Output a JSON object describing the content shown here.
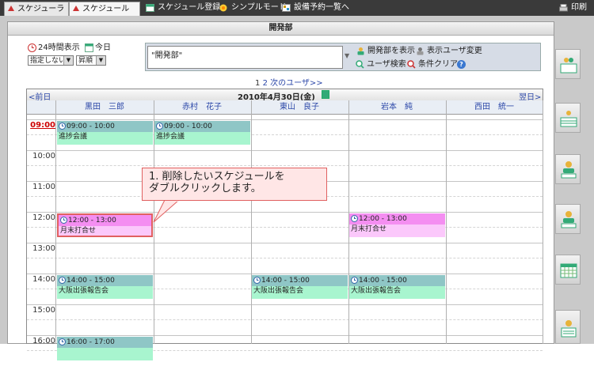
{
  "top_tabs": [
    "スケジューラ",
    "スケジュール"
  ],
  "top_links": [
    "スケジュール登録",
    "シンプルモード",
    "設備予約一覧へ"
  ],
  "print_label": "印刷",
  "panel_title": "開発部",
  "controls": {
    "show24": "24時間表示",
    "today": "今日",
    "sort_field": "指定しない",
    "sort_order": "昇順",
    "group_value": "\"開発部\"",
    "btn_show_group": "開発部を表示",
    "btn_change_users": "表示ユーザ変更",
    "btn_user_search": "ユーザ検索",
    "btn_clear": "条件クリア"
  },
  "pager": {
    "current": "1",
    "next": "2",
    "next_users": "次のユーザ>>"
  },
  "date_nav": {
    "prev": "<前日",
    "date": "2010年4月30日(金)",
    "next": "翌日>"
  },
  "users": [
    "黒田　三郎",
    "赤村　花子",
    "東山　良子",
    "岩本　純",
    "西田　統一"
  ],
  "hours": [
    "09:00",
    "10:00",
    "11:00",
    "12:00",
    "13:00",
    "14:00",
    "15:00",
    "16:00"
  ],
  "events": [
    {
      "time": "09:00 - 10:00",
      "title": "進捗会議",
      "user": "黒田　三郎",
      "color": "teal"
    },
    {
      "time": "09:00 - 10:00",
      "title": "進捗会議",
      "user": "赤村　花子",
      "color": "teal"
    },
    {
      "time": "12:00 - 13:00",
      "title": "月末打合せ",
      "user": "黒田　三郎",
      "color": "pink"
    },
    {
      "time": "12:00 - 13:00",
      "title": "月末打合せ",
      "user": "岩本　純",
      "color": "pink"
    },
    {
      "time": "14:00 - 15:00",
      "title": "大阪出張報告会",
      "user": "黒田　三郎",
      "color": "teal"
    },
    {
      "time": "14:00 - 15:00",
      "title": "大阪出張報告会",
      "user": "東山　良子",
      "color": "teal"
    },
    {
      "time": "14:00 - 15:00",
      "title": "大阪出張報告会",
      "user": "岩本　純",
      "color": "teal"
    },
    {
      "time": "16:00 - 17:00",
      "title": "",
      "user": "黒田　三郎",
      "color": "teal"
    }
  ],
  "callout": {
    "line1": "1. 削除したいスケジュールを",
    "line2": "ダブルクリックします。"
  },
  "colors": {
    "accent": "#2b47a8",
    "current_hour": "#cc0000",
    "selected_border": "#e06060",
    "teal_head": "#8fc6c6",
    "teal_body": "#a8f5cf",
    "pink_head": "#f48ef1",
    "pink_body": "#fbc8fb"
  }
}
